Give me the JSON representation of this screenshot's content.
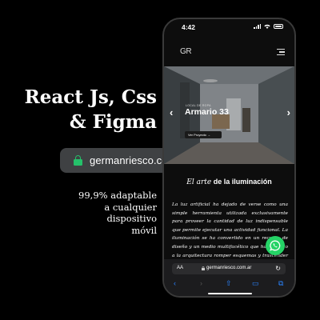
{
  "promo": {
    "headline_line1": "React Js, Css",
    "headline_line2": "& Figma",
    "url": "germanriesco.com.ar",
    "tagline_lines": [
      "99,9% adaptable",
      "a cualquier",
      "dispositivo",
      "móvil"
    ]
  },
  "phone": {
    "status_time": "4:42",
    "logo": "GR",
    "hero": {
      "subtitle": "LOCAL DE ROPA",
      "title": "Armario 33",
      "cta": "Ver Proyecto →",
      "prev": "‹",
      "next": "›"
    },
    "section": {
      "title_em": "El arte",
      "title_rest": " de la iluminación"
    },
    "body_text": "La luz artificial ha dejado de verse como una simple herramienta utilizada exclusivamente para proveer la cantidad de luz indispensable que permite ejecutar una actividad funcional. La iluminación se ha convertido en un recurso de diseño y un medio multifacético que ha ayudado a la arquitectura romper esquemas y trascender en el plano sensorial más allá del funcionamiento.",
    "browser": {
      "aa_label": "AA",
      "address": "germanriesco.com.ar",
      "reload": "↻",
      "toolbar": {
        "back": "‹",
        "forward": "›",
        "share": "⇧",
        "bookmarks": "▭",
        "tabs": "⧉"
      }
    }
  },
  "colors": {
    "accent_green": "#25c16a",
    "whatsapp_green": "#25d366",
    "safari_blue": "#2a84ff"
  }
}
